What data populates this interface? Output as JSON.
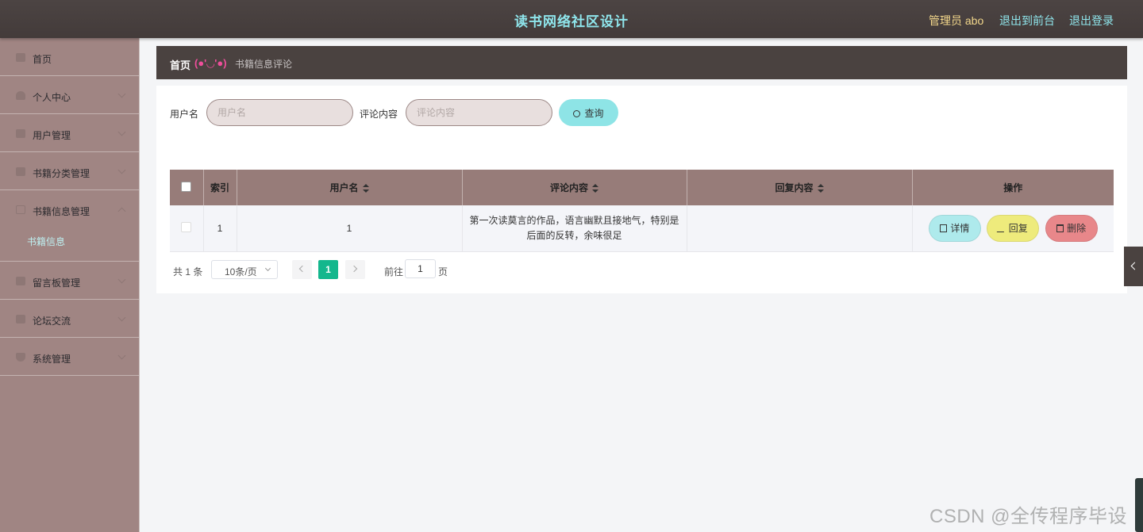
{
  "header": {
    "title": "读书网络社区设计",
    "admin_label": "管理员 abo",
    "front_link": "退出到前台",
    "logout_link": "退出登录"
  },
  "sidebar": {
    "items": [
      {
        "label": "首页",
        "icon": "home-icon"
      },
      {
        "label": "个人中心",
        "icon": "user-icon"
      },
      {
        "label": "用户管理",
        "icon": "users-icon"
      },
      {
        "label": "书籍分类管理",
        "icon": "category-icon"
      },
      {
        "label": "书籍信息管理",
        "icon": "book-icon"
      },
      {
        "label": "留言板管理",
        "icon": "message-icon"
      },
      {
        "label": "论坛交流",
        "icon": "forum-icon"
      },
      {
        "label": "系统管理",
        "icon": "system-icon"
      }
    ],
    "subitem": "书籍信息"
  },
  "breadcrumb": {
    "home": "首页",
    "face": "(●'◡'●)",
    "current": "书籍信息评论"
  },
  "search": {
    "username_label": "用户名",
    "username_placeholder": "用户名",
    "comment_label": "评论内容",
    "comment_placeholder": "评论内容",
    "query_button": "查询"
  },
  "table": {
    "headers": [
      "索引",
      "用户名",
      "评论内容",
      "回复内容",
      "操作"
    ],
    "rows": [
      {
        "index": "1",
        "username": "1",
        "comment": "第一次读莫言的作品，语言幽默且接地气，特别是后面的反转，余味很足",
        "reply": ""
      }
    ],
    "actions": {
      "detail": "详情",
      "reply": "回复",
      "delete": "删除"
    }
  },
  "pagination": {
    "total": "共 1 条",
    "page_size": "10条/页",
    "current_page": "1",
    "goto_label": "前往",
    "goto_value": "1",
    "page_unit": "页"
  },
  "watermark": "CSDN @全传程序毕设",
  "colors": {
    "header_bg": "#4a4240",
    "sidebar_bg": "#a08583",
    "accent_cyan": "#8ee4e6",
    "page_active": "#13b78d"
  }
}
